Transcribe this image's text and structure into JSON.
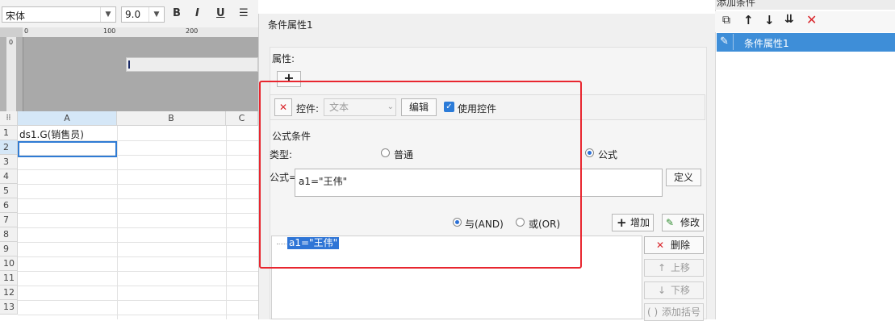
{
  "toolbar": {
    "font_name": "宋体",
    "font_size": "9.0",
    "bold": "B",
    "italic": "I",
    "underline": "U"
  },
  "designer": {
    "ruler_marks": [
      "0",
      "100",
      "200"
    ],
    "vruler_mark": "0"
  },
  "sheet": {
    "columns": [
      "A",
      "B",
      "C"
    ],
    "rows": [
      "1",
      "2",
      "3",
      "4",
      "5",
      "6",
      "7",
      "8",
      "9",
      "10",
      "11",
      "12",
      "13"
    ],
    "cell_a1": "ds1.G(销售员)"
  },
  "dialog": {
    "title": "条件属性1",
    "attr_label": "属性:",
    "add_symbol": "+",
    "control_label": "控件:",
    "control_value": "文本",
    "edit_button": "编辑",
    "use_control_label": "使用控件",
    "formula_group": "公式条件",
    "type_label": "类型:",
    "type_normal": "普通",
    "type_formula": "公式",
    "formula_label": "公式=",
    "formula_value": "a1=\"王伟\"",
    "define_button": "定义",
    "and_label": "与(AND)",
    "or_label": "或(OR)",
    "add_button": "增加",
    "modify_button": "修改",
    "list_item": "a1=\"王伟\"",
    "delete_button": "删除",
    "move_up_button": "上移",
    "move_down_button": "下移",
    "add_bracket_button": "添加括号"
  },
  "right_panel": {
    "top_label": "添加条件",
    "item": "条件属性1"
  },
  "colors": {
    "accent_blue": "#3e8ed8",
    "highlight_red": "#e8262f",
    "selected_text_bg": "#2f75d6"
  }
}
